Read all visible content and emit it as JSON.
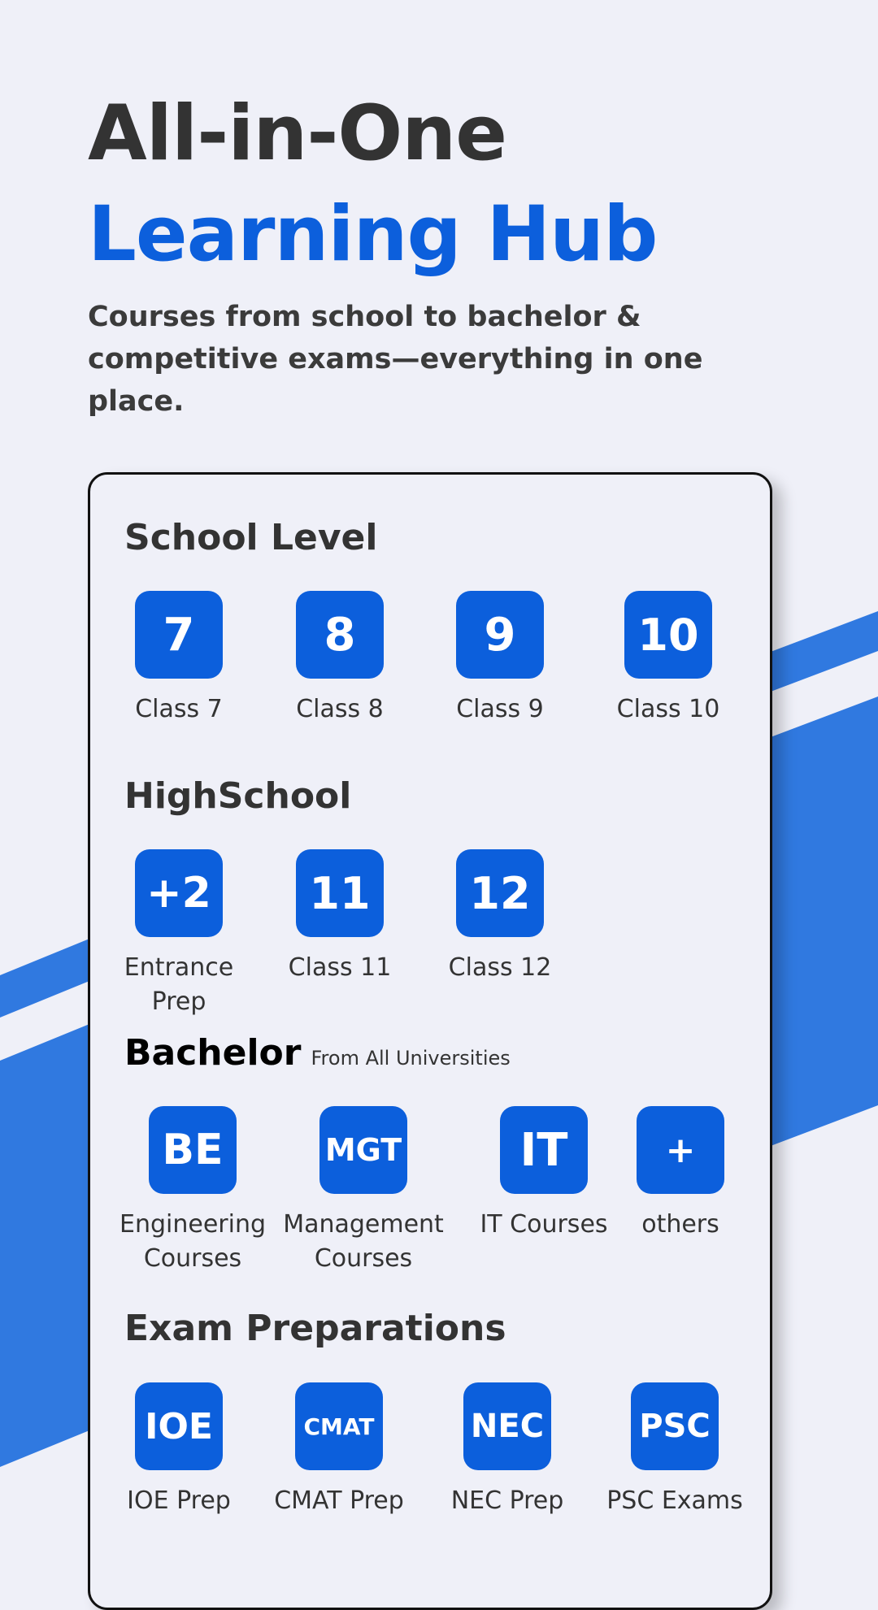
{
  "hero": {
    "title_line1": "All-in-One",
    "title_line2": "Learning Hub",
    "subtitle": "Courses from school to bachelor & competitive exams—everything in one place."
  },
  "sections": {
    "school": {
      "title": "School Level",
      "items": [
        {
          "badge": "7",
          "label": "Class 7"
        },
        {
          "badge": "8",
          "label": "Class 8"
        },
        {
          "badge": "9",
          "label": "Class 9"
        },
        {
          "badge": "10",
          "label": "Class 10"
        }
      ]
    },
    "highschool": {
      "title": "HighSchool",
      "items": [
        {
          "badge": "+2",
          "label": "Entrance Prep"
        },
        {
          "badge": "11",
          "label": "Class 11"
        },
        {
          "badge": "12",
          "label": "Class 12"
        }
      ]
    },
    "bachelor": {
      "title": "Bachelor",
      "note": "From All Universities",
      "items": [
        {
          "badge": "BE",
          "label": "Engineering Courses"
        },
        {
          "badge": "MGT",
          "label": "Management Courses"
        },
        {
          "badge": "IT",
          "label": "IT Courses"
        },
        {
          "badge": "+",
          "label": "others"
        }
      ]
    },
    "exams": {
      "title": "Exam Preparations",
      "items": [
        {
          "badge": "IOE",
          "label": "IOE Prep"
        },
        {
          "badge": "CMAT",
          "label": "CMAT Prep"
        },
        {
          "badge": "NEC",
          "label": "NEC Prep"
        },
        {
          "badge": "PSC",
          "label": "PSC Exams"
        }
      ]
    }
  },
  "colors": {
    "background": "#eff0f8",
    "accent": "#0c5fdc",
    "decor_blue": "#3079e0",
    "text_dark": "#333333"
  }
}
